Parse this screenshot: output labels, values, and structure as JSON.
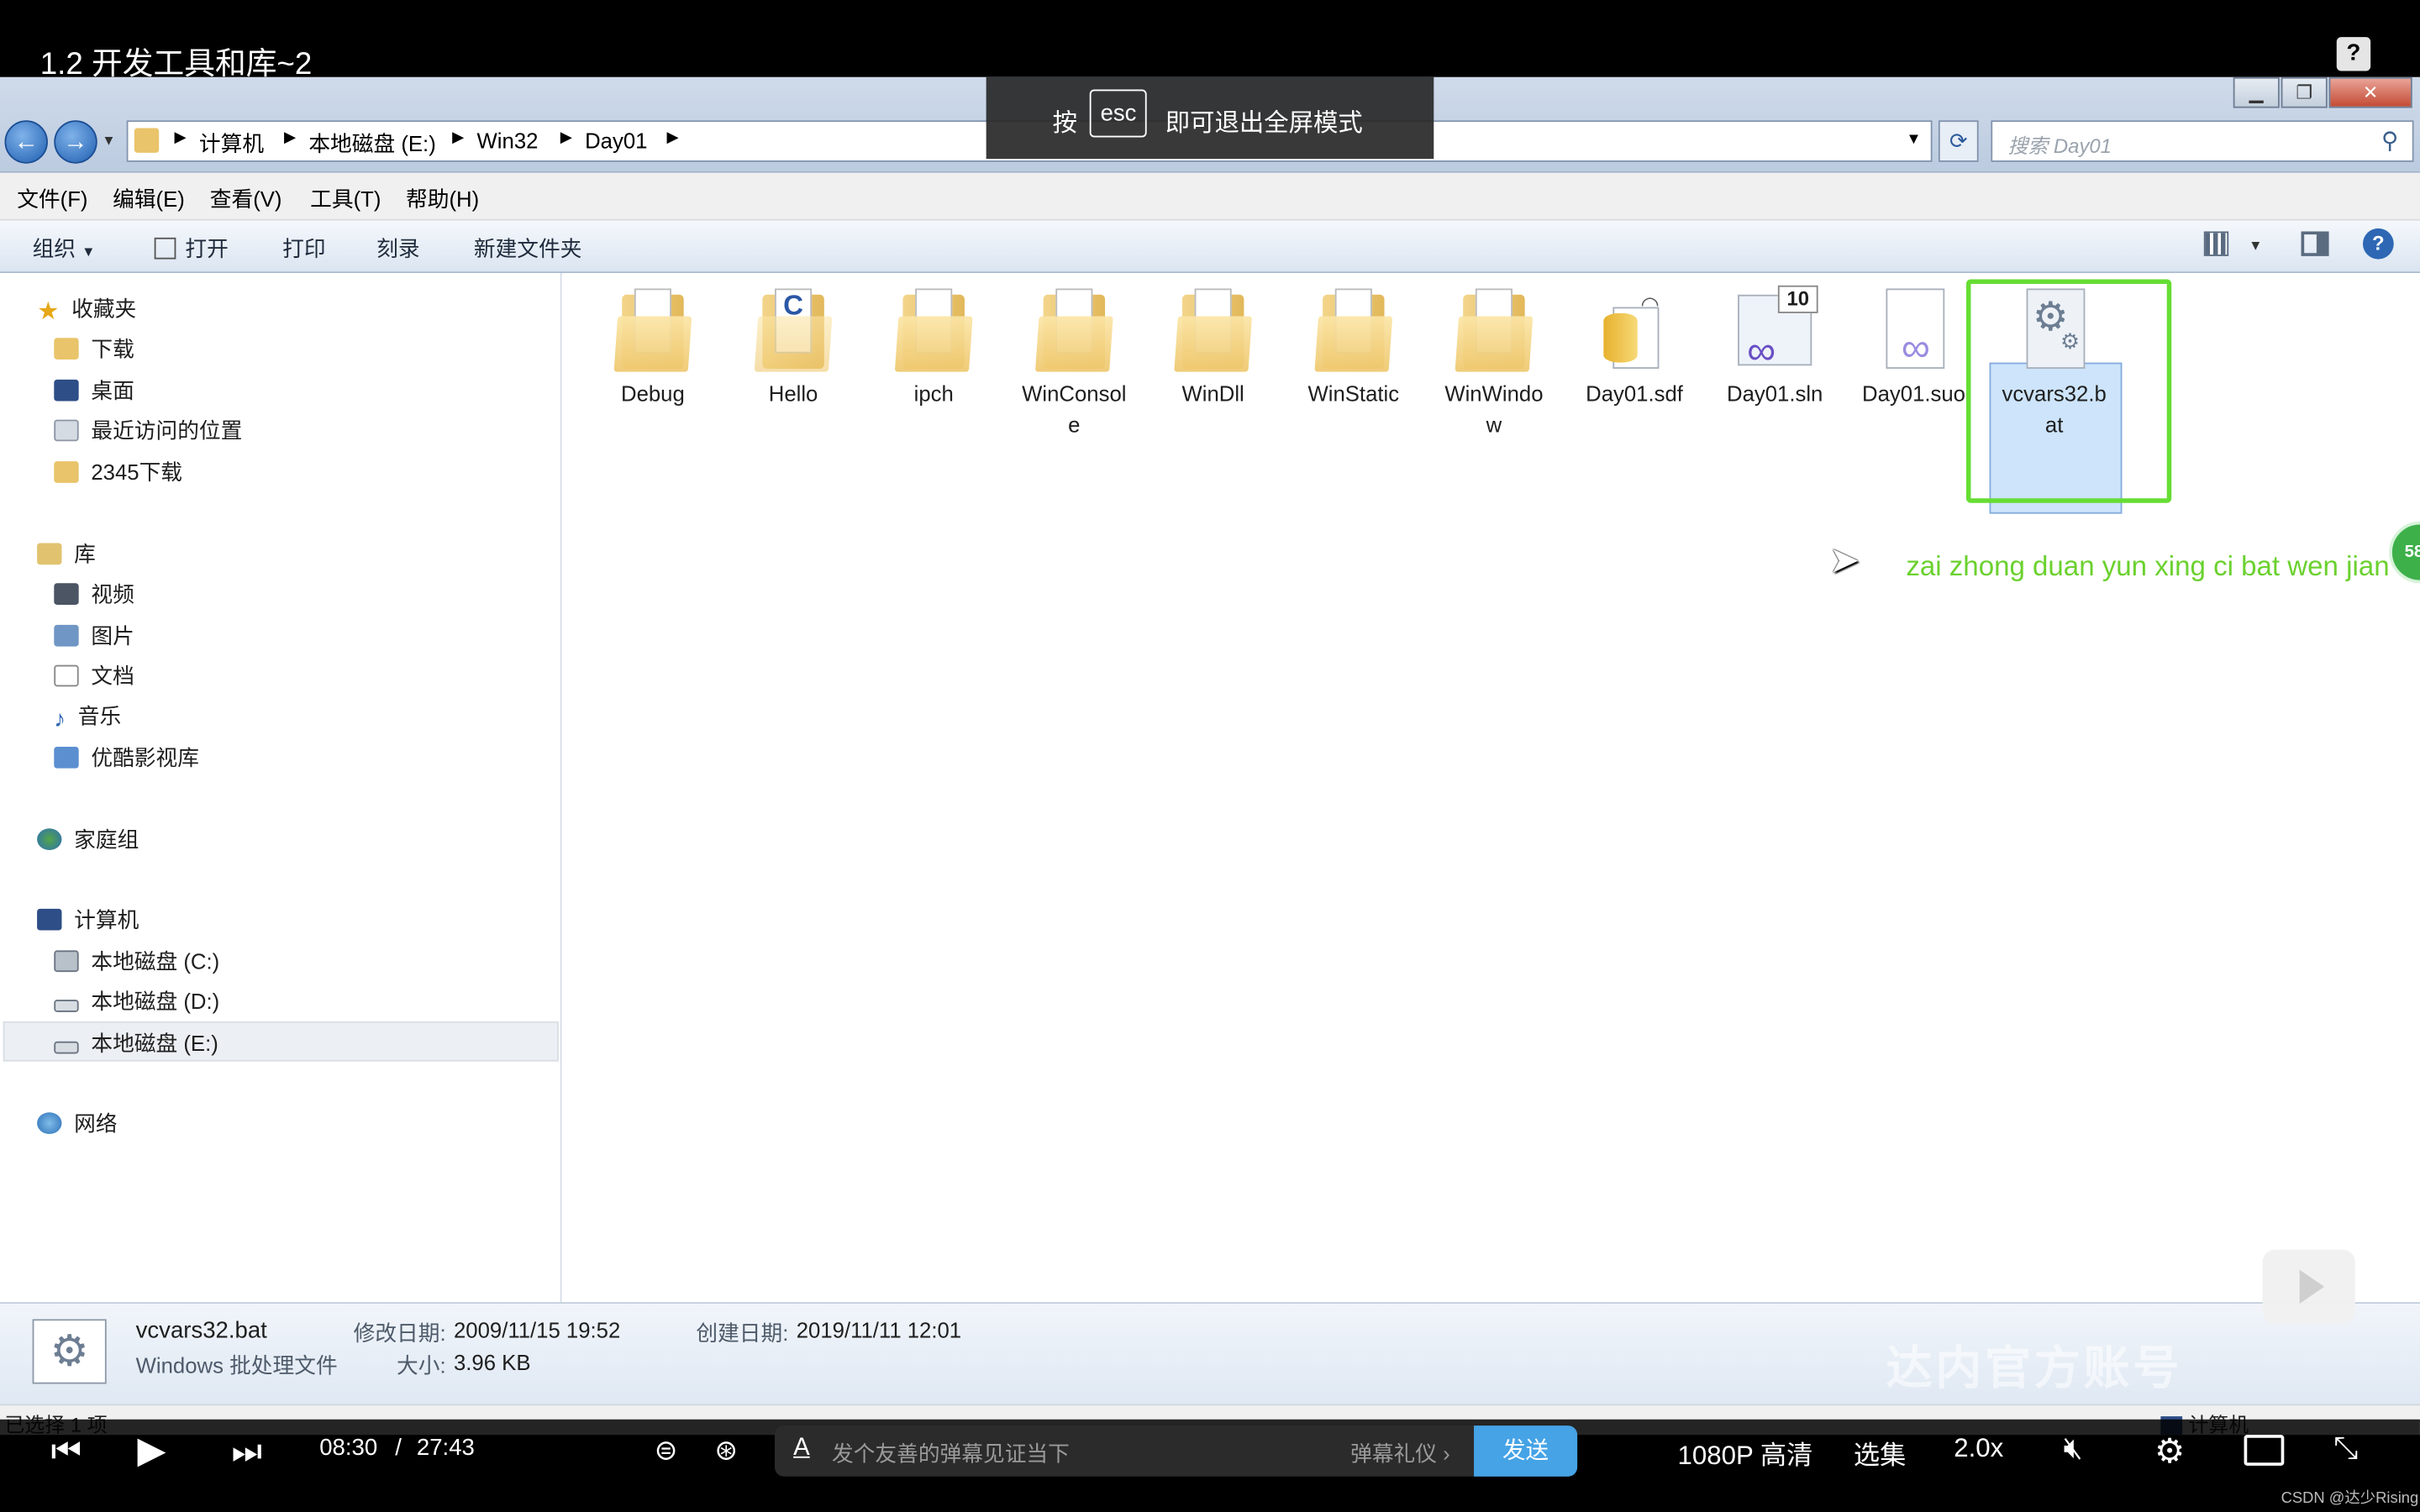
{
  "video": {
    "title": "1.2 开发工具和库~2",
    "help": "?"
  },
  "fullscreen_hint": {
    "prefix": "按",
    "key": "esc",
    "suffix": "即可退出全屏模式"
  },
  "explorer": {
    "breadcrumbs": [
      "计算机",
      "本地磁盘 (E:)",
      "Win32",
      "Day01"
    ],
    "search_placeholder": "搜索 Day01",
    "menu": [
      "文件(F)",
      "编辑(E)",
      "查看(V)",
      "工具(T)",
      "帮助(H)"
    ],
    "toolbar": {
      "organize": "组织",
      "open": "打开",
      "print": "打印",
      "burn": "刻录",
      "new_folder": "新建文件夹"
    },
    "sidebar": {
      "favorites": "收藏夹",
      "favorites_items": [
        "下载",
        "桌面",
        "最近访问的位置",
        "2345下载"
      ],
      "library": "库",
      "library_items": [
        "视频",
        "图片",
        "文档",
        "音乐",
        "优酷影视库"
      ],
      "homegroup": "家庭组",
      "computer": "计算机",
      "computer_items": [
        "本地磁盘 (C:)",
        "本地磁盘 (D:)",
        "本地磁盘 (E:)"
      ],
      "network": "网络"
    },
    "files": [
      {
        "name": "Debug",
        "type": "folder"
      },
      {
        "name": "Hello",
        "type": "folder"
      },
      {
        "name": "ipch",
        "type": "folder"
      },
      {
        "name": "WinConsole",
        "type": "folder"
      },
      {
        "name": "WinDll",
        "type": "folder"
      },
      {
        "name": "WinStatic",
        "type": "folder"
      },
      {
        "name": "WinWindow",
        "type": "folder"
      },
      {
        "name": "Day01.sdf",
        "type": "sdf"
      },
      {
        "name": "Day01.sln",
        "type": "sln"
      },
      {
        "name": "Day01.suo",
        "type": "suo"
      },
      {
        "name": "vcvars32.bat",
        "type": "bat"
      }
    ],
    "name_lines": {
      "winconsole": [
        "WinConsol",
        "e"
      ],
      "winwindow": [
        "WinWindo",
        "w"
      ],
      "vcvars": [
        "vcvars32.b",
        "at"
      ]
    },
    "sln_badge": "10",
    "annotation": "zai zhong duan yun xing ci bat wen jian",
    "details": {
      "filename": "vcvars32.bat",
      "filetype": "Windows 批处理文件",
      "modified_label": "修改日期:",
      "modified": "2009/11/15 19:52",
      "created_label": "创建日期:",
      "created": "2019/11/11 12:01",
      "size_label": "大小:",
      "size": "3.96 KB"
    },
    "status": "已选择 1 项",
    "status_right": "计算机"
  },
  "watermark": "达内官方账号",
  "side_badge": "58",
  "player": {
    "time_current": "08:30",
    "time_sep": "/",
    "time_total": "27:43",
    "danmaku_placeholder": "发个友善的弹幕见证当下",
    "etiquette": "弹幕礼仪",
    "send": "发送",
    "quality": "1080P 高清",
    "episodes": "选集",
    "speed": "2.0x"
  },
  "credit": "CSDN @达少Rising",
  "colors": {
    "annotation": "#6bd12f",
    "highlight_frame": "#66dd33",
    "send_button": "#45a3e6"
  }
}
